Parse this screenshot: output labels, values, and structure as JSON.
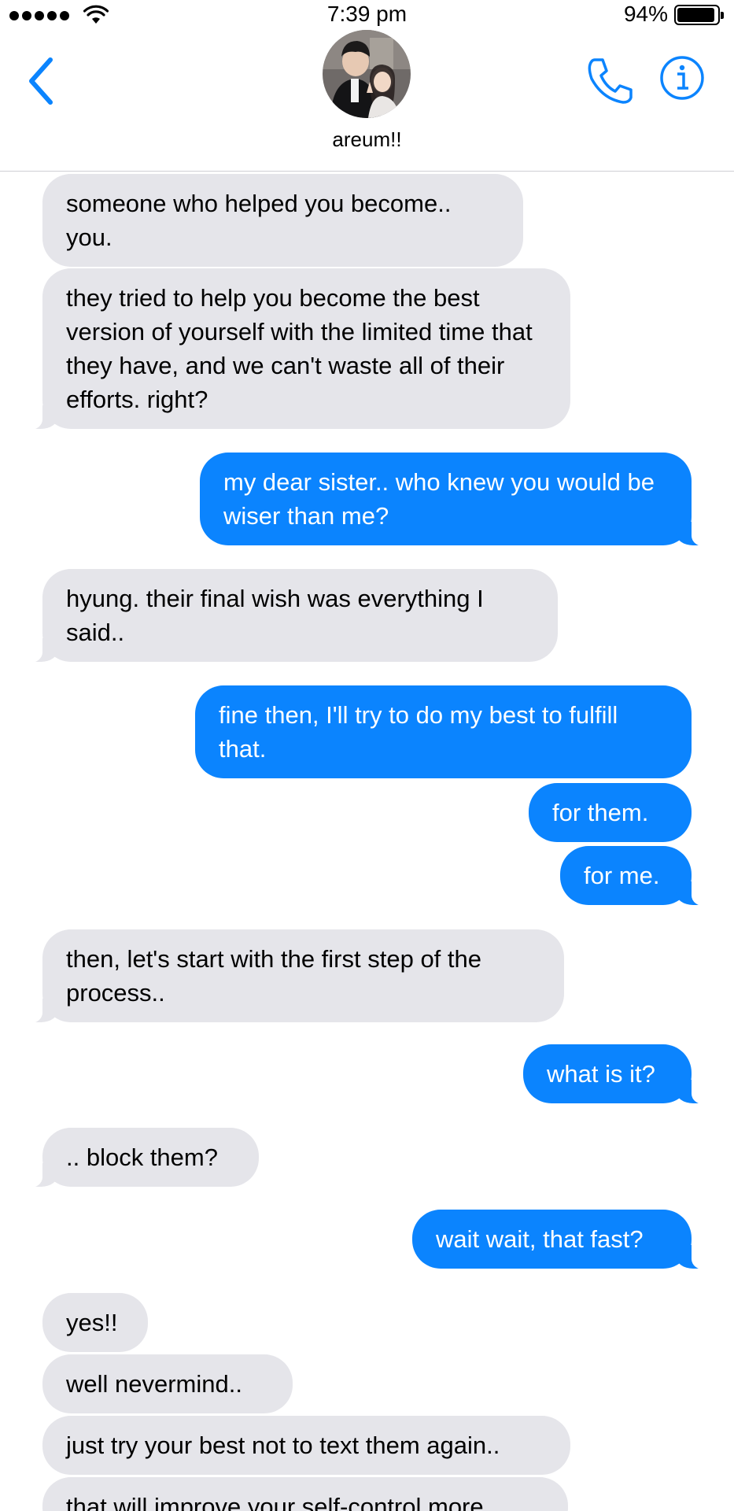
{
  "status_bar": {
    "time": "7:39 pm",
    "battery_percent": "94%",
    "signal_bars": 5,
    "battery_level": 0.94
  },
  "header": {
    "contact_name": "areum!!",
    "back_icon": "chevron-left-icon",
    "call_icon": "phone-icon",
    "info_icon": "info-icon",
    "accent_color": "#0b84fe"
  },
  "messages": [
    {
      "from": "them",
      "text": "someone who helped you become.. you."
    },
    {
      "from": "them",
      "text": "they tried to help you become the best version of yourself with the limited time that they have, and we can't waste all of their efforts. right?"
    },
    {
      "from": "me",
      "text": "my dear sister.. who knew you would be wiser than me?"
    },
    {
      "from": "them",
      "text": "hyung. their final wish was everything I said.."
    },
    {
      "from": "me",
      "text": "fine then, I'll try to do my best to fulfill that."
    },
    {
      "from": "me",
      "text": "for them."
    },
    {
      "from": "me",
      "text": "for me."
    },
    {
      "from": "them",
      "text": "then, let's start with the first step of the process.."
    },
    {
      "from": "me",
      "text": "what is it?"
    },
    {
      "from": "them",
      "text": ".. block them?"
    },
    {
      "from": "me",
      "text": "wait wait, that fast?"
    },
    {
      "from": "them",
      "text": "yes!!"
    },
    {
      "from": "them",
      "text": "well nevermind.."
    },
    {
      "from": "them",
      "text": "just try your best not to text them again.."
    },
    {
      "from": "them",
      "text": "that will improve your self-control more"
    }
  ],
  "colors": {
    "incoming_bubble": "#e5e5ea",
    "outgoing_bubble": "#0b84fe"
  }
}
